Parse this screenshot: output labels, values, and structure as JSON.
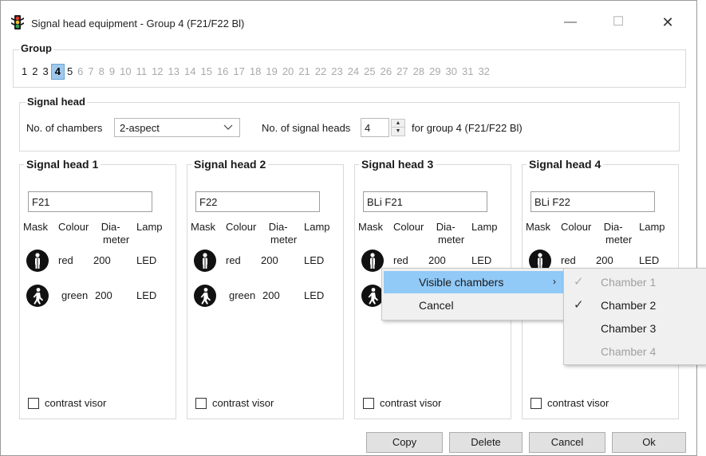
{
  "window": {
    "title": "Signal head equipment - Group 4 (F21/F22 Bl)",
    "icon": "traffic-light-icon",
    "controls": {
      "minimize": "—",
      "maximize": "☐",
      "close": "✕"
    }
  },
  "group": {
    "title": "Group",
    "numbers": [
      "1",
      "2",
      "3",
      "4",
      "5",
      "6",
      "7",
      "8",
      "9",
      "10",
      "11",
      "12",
      "13",
      "14",
      "15",
      "16",
      "17",
      "18",
      "19",
      "20",
      "21",
      "22",
      "23",
      "24",
      "25",
      "26",
      "27",
      "28",
      "29",
      "30",
      "31",
      "32"
    ],
    "selected": "4",
    "enabled_count": 5
  },
  "signal_head": {
    "title": "Signal head",
    "chambers_label": "No. of chambers",
    "chambers_value": "2-aspect",
    "heads_label": "No. of signal heads",
    "heads_value": "4",
    "for_group_label": "for group 4 (F21/F22 Bl)"
  },
  "panels": [
    {
      "title": "Signal head 1",
      "name": "F21"
    },
    {
      "title": "Signal head 2",
      "name": "F22"
    },
    {
      "title": "Signal head 3",
      "name": "BLi F21"
    },
    {
      "title": "Signal head 4",
      "name": "BLi F22"
    }
  ],
  "columns": {
    "mask": "Mask",
    "colour": "Colour",
    "diameter_1": "Dia-",
    "diameter_2": "meter",
    "lamp": "Lamp"
  },
  "rows": [
    {
      "icon": "pedestrian-standing-icon",
      "colour": "red",
      "diameter": "200",
      "lamp": "LED"
    },
    {
      "icon": "pedestrian-walking-icon",
      "colour": "green",
      "diameter": "200",
      "lamp": "LED"
    }
  ],
  "contrast_visor_label": "contrast visor",
  "buttons": {
    "copy": "Copy",
    "delete": "Delete",
    "cancel": "Cancel",
    "ok": "Ok"
  },
  "context_menu": {
    "items": [
      {
        "label": "Visible chambers",
        "arrow": "›"
      },
      {
        "label": "Cancel"
      }
    ]
  },
  "submenu": {
    "items": [
      {
        "label": "Chamber 1",
        "checked": true,
        "disabled": true
      },
      {
        "label": "Chamber 2",
        "checked": true,
        "disabled": false
      },
      {
        "label": "Chamber 3",
        "checked": false,
        "disabled": false
      },
      {
        "label": "Chamber 4",
        "checked": false,
        "disabled": true
      }
    ]
  },
  "colors": {
    "highlight": "#91c9f7",
    "active_group": "#9fc8ec"
  }
}
